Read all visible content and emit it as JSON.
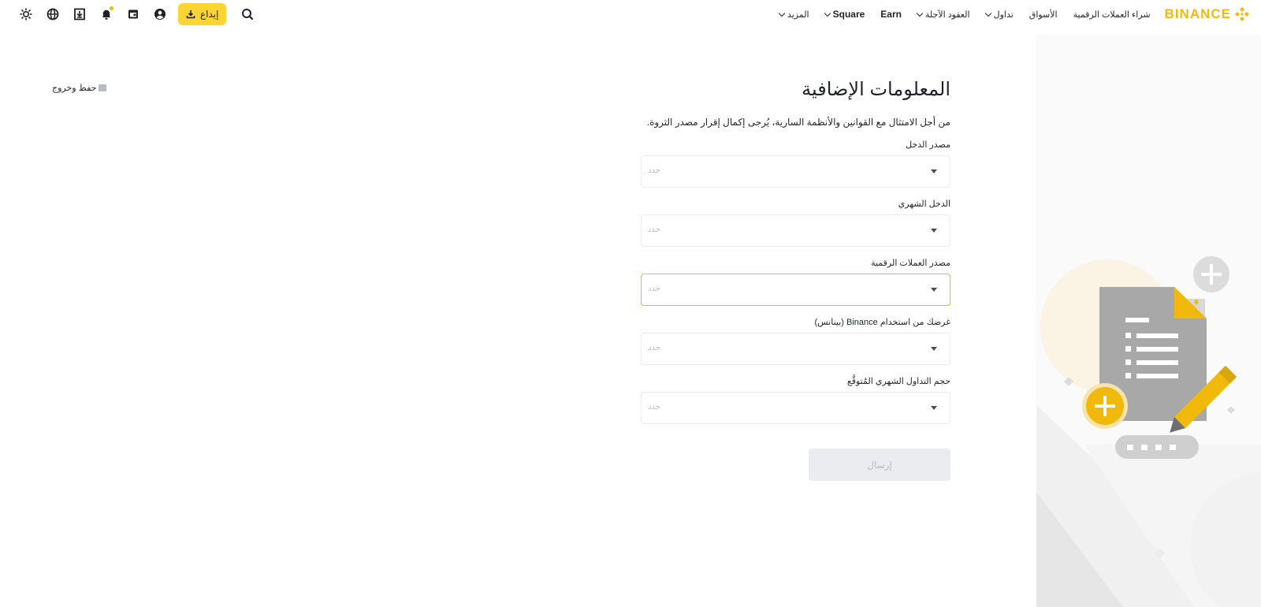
{
  "header": {
    "logo_text": "BINANCE",
    "nav": [
      {
        "label": "شراء العملات الرقمية",
        "has_caret": false
      },
      {
        "label": "الأسواق",
        "has_caret": false
      },
      {
        "label": "تداول",
        "has_caret": true
      },
      {
        "label": "العقود الآجلة",
        "has_caret": true
      },
      {
        "label": "Earn",
        "has_caret": false
      },
      {
        "label": "Square",
        "has_caret": true
      },
      {
        "label": "المزيد",
        "has_caret": true
      }
    ],
    "search_icon": "search-icon",
    "deposit_label": "إيداع",
    "icons": [
      "theme-toggle-icon",
      "globe-icon",
      "download-app-icon",
      "bell-icon",
      "wallet-icon",
      "profile-icon"
    ]
  },
  "save_exit": {
    "label": "حفظ وخروج"
  },
  "form": {
    "title": "المعلومات الإضافية",
    "description": "من أجل الامتثال مع القوانين والأنظمة السارية، يُرجى إكمال إقرار مصدر الثروة.",
    "fields": [
      {
        "label": "مصدر الدخل",
        "placeholder": "حدد"
      },
      {
        "label": "الدخل الشهري",
        "placeholder": "حدد"
      },
      {
        "label": "مصدر العملات الرقمية",
        "placeholder": "حدد"
      },
      {
        "label": "غرضك من استخدام Binance (بينانس)",
        "placeholder": "حدد"
      },
      {
        "label": "حجم التداول الشهري المُتوقَّع",
        "placeholder": "حدد"
      }
    ],
    "focused_field_index": 2,
    "submit_label": "إرسال"
  },
  "colors": {
    "brand_yellow": "#f0b90b",
    "button_yellow": "#fcd535",
    "text": "#1e2329",
    "muted": "#b7bdc6",
    "border": "#eaecef"
  }
}
